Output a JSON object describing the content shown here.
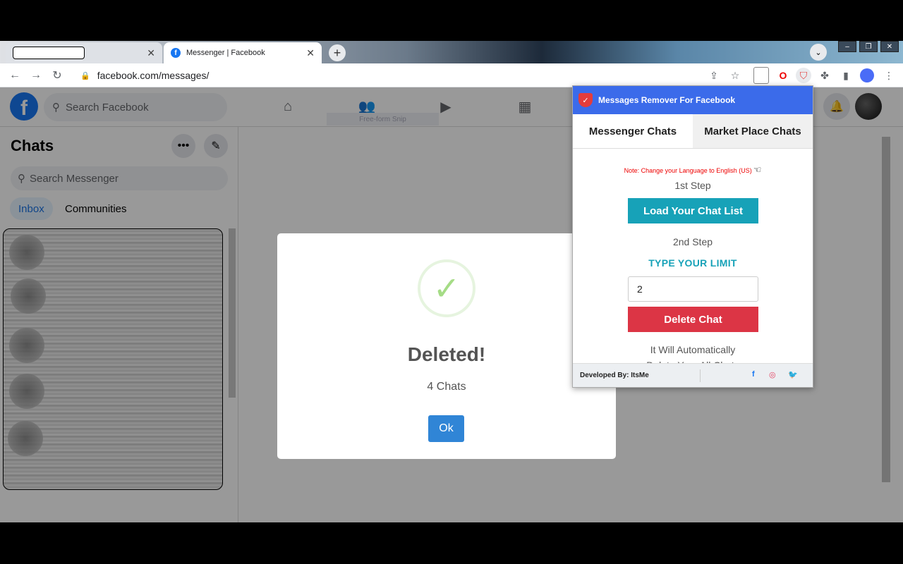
{
  "browser": {
    "tabs": [
      {
        "label": ""
      },
      {
        "label": "Messenger | Facebook"
      }
    ],
    "url": "facebook.com/messages/"
  },
  "facebook": {
    "search_placeholder": "Search Facebook",
    "snip_label": "Free-form Snip",
    "chats_title": "Chats",
    "messenger_search_placeholder": "Search Messenger",
    "inbox_tab": "Inbox",
    "communities_tab": "Communities"
  },
  "dialog": {
    "title": "Deleted!",
    "text": "4 Chats",
    "ok_label": "Ok"
  },
  "extension": {
    "title": "Messages Remover For Facebook",
    "tabs": [
      "Messenger Chats",
      "Market Place Chats"
    ],
    "note": "Note: Change your Language to English (US)",
    "step1": "1st Step",
    "load_button": "Load Your Chat List",
    "step2": "2nd Step",
    "limit_label": "TYPE YOUR LIMIT",
    "limit_value": "2",
    "delete_button": "Delete Chat",
    "auto_text_1": "It Will Automatically",
    "auto_text_2": "Delete Your All Chats",
    "footer": "Developed By: ItsMe",
    "social": [
      "f",
      "◎",
      "🐦"
    ]
  },
  "colors": {
    "facebook_blue": "#1877f2",
    "popup_header": "#3b6bea",
    "load_button": "#17a2b8",
    "delete_button": "#dc3545",
    "ok_button": "#3085d6",
    "success_check": "#a5dc86"
  }
}
